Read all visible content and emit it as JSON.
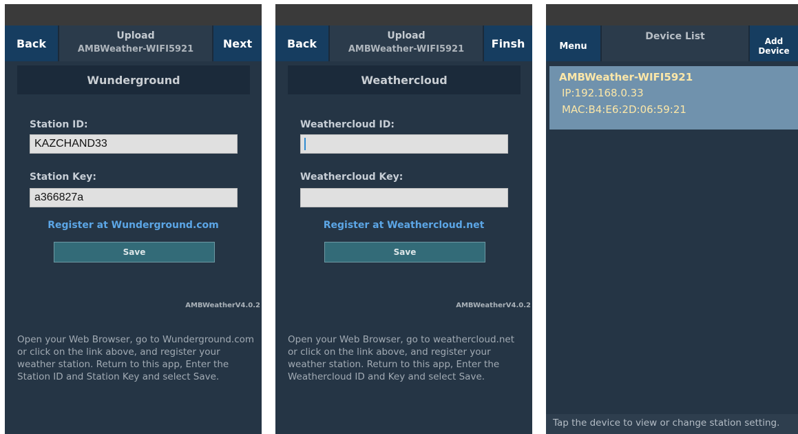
{
  "wunderground": {
    "nav": {
      "back": "Back",
      "title_line1": "Upload",
      "title_line2": "AMBWeather-WIFI5921",
      "next": "Next"
    },
    "section_title": "Wunderground",
    "station_id_label": "Station ID:",
    "station_id_value": "KAZCHAND33",
    "station_key_label": "Station Key:",
    "station_key_value": "a366827a",
    "register_link": "Register at Wunderground.com",
    "save_label": "Save",
    "version": "AMBWeatherV4.0.2",
    "help_text": "Open your Web Browser, go to Wunderground.com or click on the link above, and register your weather station. Return to this app, Enter the Station ID and Station Key and select Save."
  },
  "weathercloud": {
    "nav": {
      "back": "Back",
      "title_line1": "Upload",
      "title_line2": "AMBWeather-WIFI5921",
      "next": "Finsh"
    },
    "section_title": "Weathercloud",
    "id_label": "Weathercloud ID:",
    "id_value": "",
    "key_label": "Weathercloud Key:",
    "key_value": "",
    "register_link": "Register at Weathercloud.net",
    "save_label": "Save",
    "version": "AMBWeatherV4.0.2",
    "help_text": "Open your Web Browser, go to weathercloud.net or click on the link above, and register your weather station. Return to this app, Enter the Weathercloud ID and Key and select Save."
  },
  "device_list": {
    "nav": {
      "menu": "Menu",
      "title": "Device List",
      "add_line1": "Add",
      "add_line2": "Device"
    },
    "devices": [
      {
        "name": "AMBWeather-WIFI5921",
        "ip": "IP:192.168.0.33",
        "mac": "MAC:B4:E6:2D:06:59:21"
      }
    ],
    "footer": "Tap the device to view or change station setting."
  },
  "colors": {
    "panel_bg": "#253545",
    "nav_button": "#163d60",
    "link": "#5ca6e6",
    "save_button": "#336b78",
    "selected_row": "#7092ad",
    "device_text": "#fce7a8"
  }
}
